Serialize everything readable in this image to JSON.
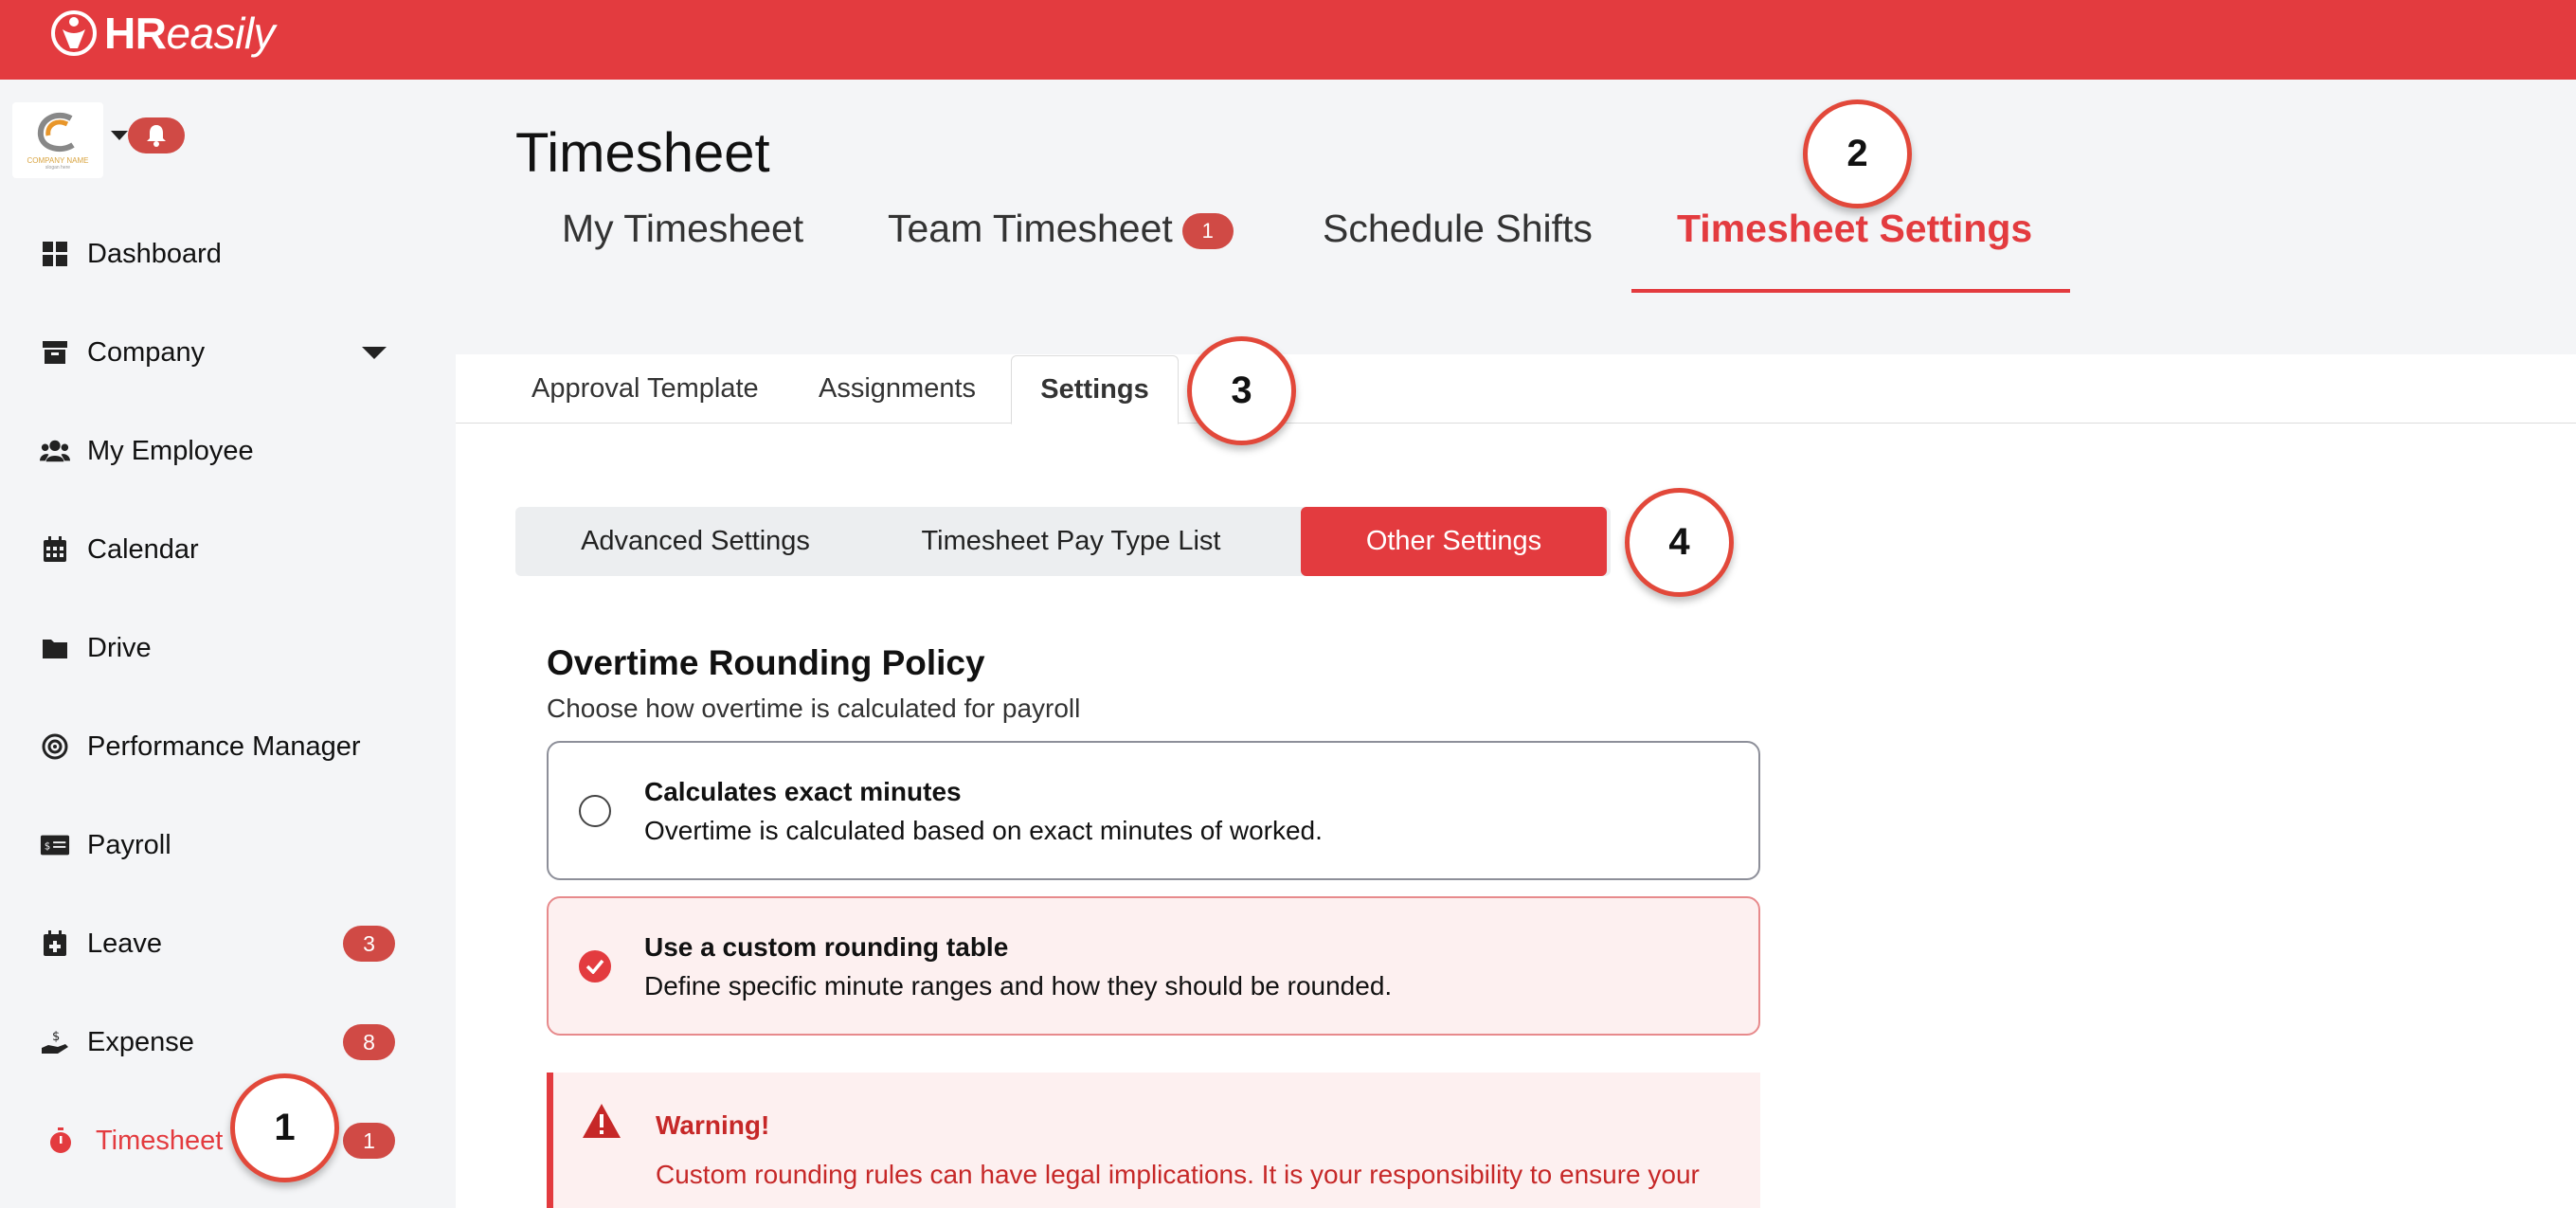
{
  "brand": {
    "name_bold": "HR",
    "name_rest": "easily"
  },
  "company_logo": {
    "text": "COMPANY NAME",
    "tagline": "slogan here"
  },
  "sidebar": {
    "items": [
      {
        "label": "Dashboard",
        "icon": "grid-icon"
      },
      {
        "label": "Company",
        "icon": "archive-icon"
      },
      {
        "label": "My Employee",
        "icon": "users-icon"
      },
      {
        "label": "Calendar",
        "icon": "calendar-icon"
      },
      {
        "label": "Drive",
        "icon": "folder-icon"
      },
      {
        "label": "Performance Manager",
        "icon": "target-icon"
      },
      {
        "label": "Payroll",
        "icon": "money-card-icon"
      },
      {
        "label": "Leave",
        "icon": "calendar-plus-icon",
        "badge": "3"
      },
      {
        "label": "Expense",
        "icon": "hand-money-icon",
        "badge": "8"
      },
      {
        "label": "Timesheet",
        "icon": "stopwatch-icon",
        "badge": "1"
      }
    ]
  },
  "main": {
    "title": "Timesheet",
    "tabs": [
      {
        "label": "My Timesheet"
      },
      {
        "label": "Team Timesheet",
        "badge": "1"
      },
      {
        "label": "Schedule Shifts"
      },
      {
        "label": "Timesheet Settings"
      }
    ],
    "subtabs": [
      {
        "label": "Approval Template"
      },
      {
        "label": "Assignments"
      },
      {
        "label": "Settings"
      }
    ],
    "segments": [
      {
        "label": "Advanced Settings"
      },
      {
        "label": "Timesheet Pay Type List"
      },
      {
        "label": "Other Settings"
      }
    ],
    "section": {
      "title": "Overtime Rounding Policy",
      "subtitle": "Choose how overtime is calculated for payroll",
      "options": [
        {
          "title": "Calculates exact minutes",
          "description": "Overtime is calculated based on exact minutes of worked.",
          "selected": false
        },
        {
          "title": "Use a custom rounding table",
          "description": "Define specific minute ranges and how they should be rounded.",
          "selected": true
        }
      ]
    },
    "warning": {
      "title": "Warning!",
      "text": "Custom rounding rules can have legal implications. It is your responsibility to ensure your policy is fair and compliant with all applicable labor laws. We strongly advise consulting with"
    }
  },
  "annotations": [
    "1",
    "2",
    "3",
    "4"
  ],
  "colors": {
    "brand_red": "#e33b3f",
    "badge_red": "#d04a45",
    "annotation_ring": "#e2483a"
  }
}
